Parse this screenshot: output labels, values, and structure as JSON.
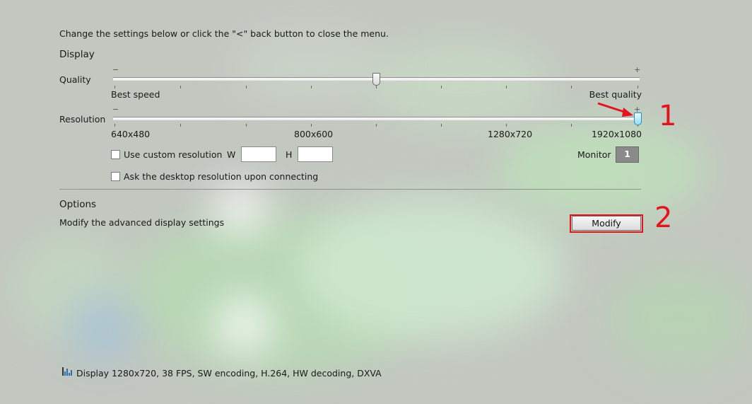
{
  "intro": "Change the settings below or click the \"<\" back button to close the menu.",
  "display": {
    "heading": "Display",
    "quality": {
      "label": "Quality",
      "minus": "−",
      "plus": "+",
      "left_caption": "Best speed",
      "right_caption": "Best quality",
      "value_fraction": 0.5
    },
    "resolution": {
      "label": "Resolution",
      "minus": "−",
      "plus": "+",
      "tick_labels": [
        "640x480",
        "800x600",
        "1280x720",
        "1920x1080"
      ],
      "value_fraction": 1.0
    },
    "custom_resolution": {
      "label": "Use custom resolution",
      "checked": false,
      "w_label": "W",
      "h_label": "H",
      "w_value": "",
      "h_value": ""
    },
    "monitor": {
      "label": "Monitor",
      "value": "1"
    },
    "ask_desktop": {
      "label": "Ask the desktop resolution upon connecting",
      "checked": false
    }
  },
  "options": {
    "heading": "Options",
    "description": "Modify the advanced display settings",
    "button_label": "Modify"
  },
  "annotations": {
    "callout_1": "1",
    "callout_2": "2",
    "color": "#e3141b"
  },
  "status_bar": {
    "icon": "bar-chart-icon",
    "text": "Display 1280x720, 38 FPS, SW encoding, H.264, HW decoding, DXVA"
  }
}
